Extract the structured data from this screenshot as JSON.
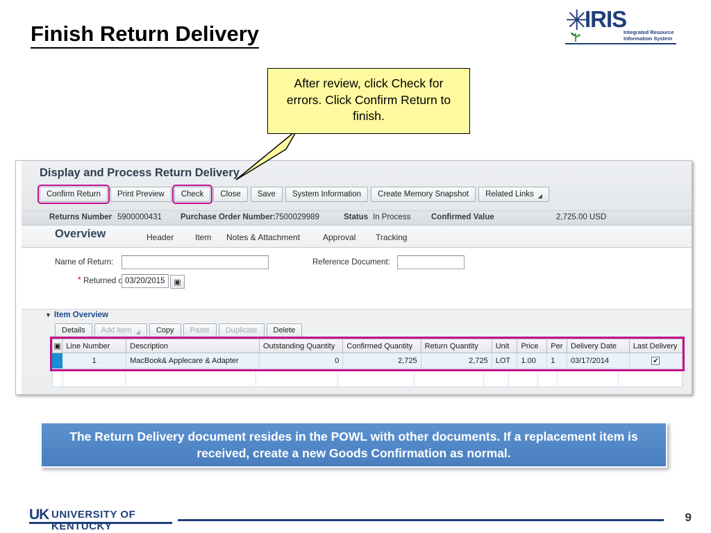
{
  "slide": {
    "title": "Finish Return Delivery",
    "page_number": "9"
  },
  "logo": {
    "brand": "IRIS",
    "sub_line1": "Integrated Resource",
    "sub_line2": "Information System",
    "star_icon": "flower-icon"
  },
  "callout": {
    "text": "After review, click Check for errors. Click Confirm Return to finish."
  },
  "app": {
    "title": "Display and Process Return Delivery",
    "toolbar": [
      {
        "label": "Confirm Return",
        "highlight": true
      },
      {
        "label": "Print Preview",
        "highlight": false
      },
      {
        "label": "Check",
        "highlight": true
      },
      {
        "label": "Close",
        "highlight": false
      },
      {
        "label": "Save",
        "highlight": false
      },
      {
        "label": "System Information",
        "highlight": false
      },
      {
        "label": "Create Memory Snapshot",
        "highlight": false
      },
      {
        "label": "Related Links",
        "highlight": false,
        "caret": true
      }
    ],
    "status": {
      "returns_number_label": "Returns Number",
      "returns_number_value": "5900000431",
      "purchase_order_label": "Purchase Order Number:",
      "purchase_order_value": "7500029989",
      "status_label": "Status",
      "status_value": "In Process",
      "confirmed_value_label": "Confirmed Value",
      "confirmed_value_value": "2,725.00 USD"
    },
    "tabs": [
      {
        "label": "Overview",
        "active": true
      },
      {
        "label": "Header",
        "active": false
      },
      {
        "label": "Item",
        "active": false
      },
      {
        "label": "Notes & Attachment",
        "active": false
      },
      {
        "label": "Approval",
        "active": false
      },
      {
        "label": "Tracking",
        "active": false
      }
    ],
    "form": {
      "name_of_return_label": "Name of Return:",
      "name_of_return_value": "",
      "name_of_return_placeholder": "",
      "reference_document_label": "Reference Document:",
      "reference_document_value": "",
      "returned_on_label": "Returned on:",
      "returned_on_value": "03/20/2015",
      "required_marker": "*",
      "date_picker_icon": "calendar-icon"
    },
    "item_overview": {
      "section_label": "Item Overview",
      "collapse_icon": "triangle-down-icon",
      "buttons": [
        {
          "label": "Details",
          "disabled": false,
          "caret": false
        },
        {
          "label": "Add Item",
          "disabled": true,
          "caret": true
        },
        {
          "label": "Copy",
          "disabled": false,
          "caret": false
        },
        {
          "label": "Paste",
          "disabled": true,
          "caret": false
        },
        {
          "label": "Duplicate",
          "disabled": true,
          "caret": false
        },
        {
          "label": "Delete",
          "disabled": false,
          "caret": false
        }
      ],
      "columns": [
        "Line Number",
        "Description",
        "Outstanding Quantity",
        "Confirmed Quantity",
        "Return Quantity",
        "Unit",
        "Price",
        "Per",
        "Delivery Date",
        "Last Delivery"
      ],
      "select_all_icon": "select-all-icon",
      "rows": [
        {
          "line_number": "1",
          "description": "MacBook& Applecare & Adapter",
          "outstanding_quantity": "0",
          "confirmed_quantity": "2,725",
          "return_quantity": "2,725",
          "unit": "LOT",
          "price": "1.00",
          "per": "1",
          "delivery_date": "03/17/2014",
          "last_delivery_checked": "✔"
        }
      ]
    }
  },
  "banner": {
    "text": "The Return Delivery document resides in the POWL with other documents. If a replacement item is received, create a new Goods Confirmation as normal."
  },
  "footer": {
    "uk_mark": "UK",
    "uk_name": "UNIVERSITY OF KENTUCKY"
  },
  "colors": {
    "highlight_magenta": "#c3118f",
    "callout_yellow": "#fffaa0",
    "banner_blue": "#4a7fbf",
    "brand_navy": "#1f3f7a",
    "row_select_blue": "#1a8fd1"
  }
}
